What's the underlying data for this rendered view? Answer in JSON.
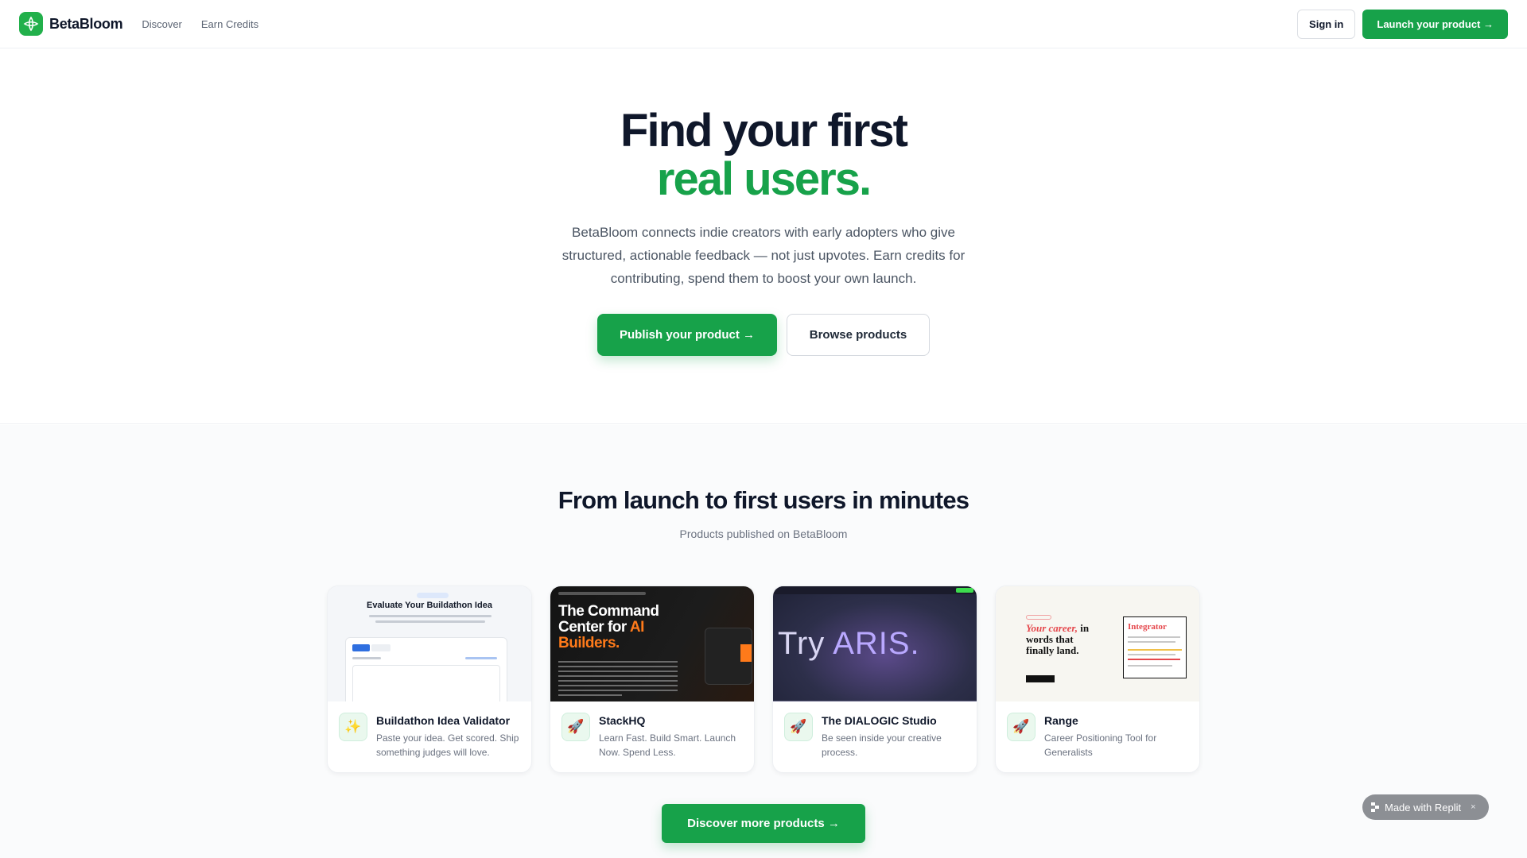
{
  "nav": {
    "brand": "BetaBloom",
    "links": [
      "Discover",
      "Earn Credits"
    ],
    "signin_label": "Sign in",
    "launch_label": "Launch your product →"
  },
  "hero": {
    "title_line1": "Find your first",
    "title_line2": "real users.",
    "subtitle": "BetaBloom connects indie creators with early adopters who give structured, actionable feedback — not just upvotes. Earn credits for contributing, spend them to boost your own launch.",
    "publish_label": "Publish your product →",
    "browse_label": "Browse products"
  },
  "section": {
    "title": "From launch to first users in minutes",
    "subtitle": "Products published on BetaBloom",
    "cards": [
      {
        "name": "Buildathon Idea Validator",
        "description": "Paste your idea. Get scored. Ship something judges will love.",
        "icon": "sparkles-icon",
        "icon_glyph": "✨",
        "thumb_title": "Evaluate Your Buildathon Idea"
      },
      {
        "name": "StackHQ",
        "description": "Learn Fast. Build Smart. Launch Now. Spend Less.",
        "icon": "rocket-icon",
        "icon_glyph": "🚀",
        "thumb_line1": "The Command",
        "thumb_line2": "Center for ",
        "thumb_accent": "AI",
        "thumb_line3": "Builders."
      },
      {
        "name": "The DIALOGIC Studio",
        "description": "Be seen inside your creative process.",
        "icon": "rocket-icon",
        "icon_glyph": "🚀",
        "thumb_try": "Try ",
        "thumb_aris": "ARIS."
      },
      {
        "name": "Range",
        "description": "Career Positioning Tool for Generalists",
        "icon": "rocket-icon",
        "icon_glyph": "🚀",
        "thumb_head_a": "Your career,",
        "thumb_head_b": " in",
        "thumb_head_c": "words that",
        "thumb_head_d": "finally land.",
        "thumb_doc_title": "Integrator"
      }
    ],
    "discover_label": "Discover more products →"
  },
  "badge": {
    "label": "Made with Replit",
    "close": "×"
  },
  "colors": {
    "brand_green": "#17a24a",
    "text_dark": "#0f172a",
    "text_muted": "#6b7280"
  }
}
